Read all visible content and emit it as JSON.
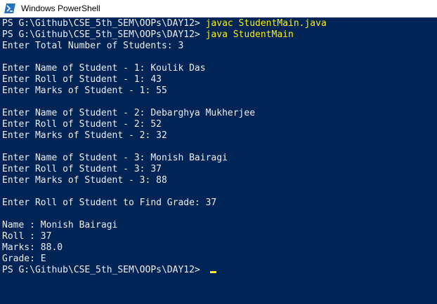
{
  "window": {
    "title": "Windows PowerShell",
    "icon": "powershell-icon",
    "colors": {
      "background": "#012456",
      "text": "#eeedf0",
      "command": "#fcee0a"
    }
  },
  "console": {
    "lines": [
      {
        "prompt": "PS G:\\Github\\CSE_5th_SEM\\OOPs\\DAY12> ",
        "command": "javac StudentMain.java"
      },
      {
        "prompt": "PS G:\\Github\\CSE_5th_SEM\\OOPs\\DAY12> ",
        "command": "java StudentMain"
      },
      {
        "text": "Enter Total Number of Students: 3"
      },
      {
        "text": ""
      },
      {
        "text": "Enter Name of Student - 1: Koulik Das"
      },
      {
        "text": "Enter Roll of Student - 1: 43"
      },
      {
        "text": "Enter Marks of Student - 1: 55"
      },
      {
        "text": ""
      },
      {
        "text": "Enter Name of Student - 2: Debarghya Mukherjee"
      },
      {
        "text": "Enter Roll of Student - 2: 52"
      },
      {
        "text": "Enter Marks of Student - 2: 32"
      },
      {
        "text": ""
      },
      {
        "text": "Enter Name of Student - 3: Monish Bairagi"
      },
      {
        "text": "Enter Roll of Student - 3: 37"
      },
      {
        "text": "Enter Marks of Student - 3: 88"
      },
      {
        "text": ""
      },
      {
        "text": "Enter Roll of Student to Find Grade: 37"
      },
      {
        "text": ""
      },
      {
        "text": "Name : Monish Bairagi"
      },
      {
        "text": "Roll : 37"
      },
      {
        "text": "Marks: 88.0"
      },
      {
        "text": "Grade: E"
      },
      {
        "prompt": "PS G:\\Github\\CSE_5th_SEM\\OOPs\\DAY12> ",
        "command": "",
        "cursor": true
      }
    ]
  }
}
